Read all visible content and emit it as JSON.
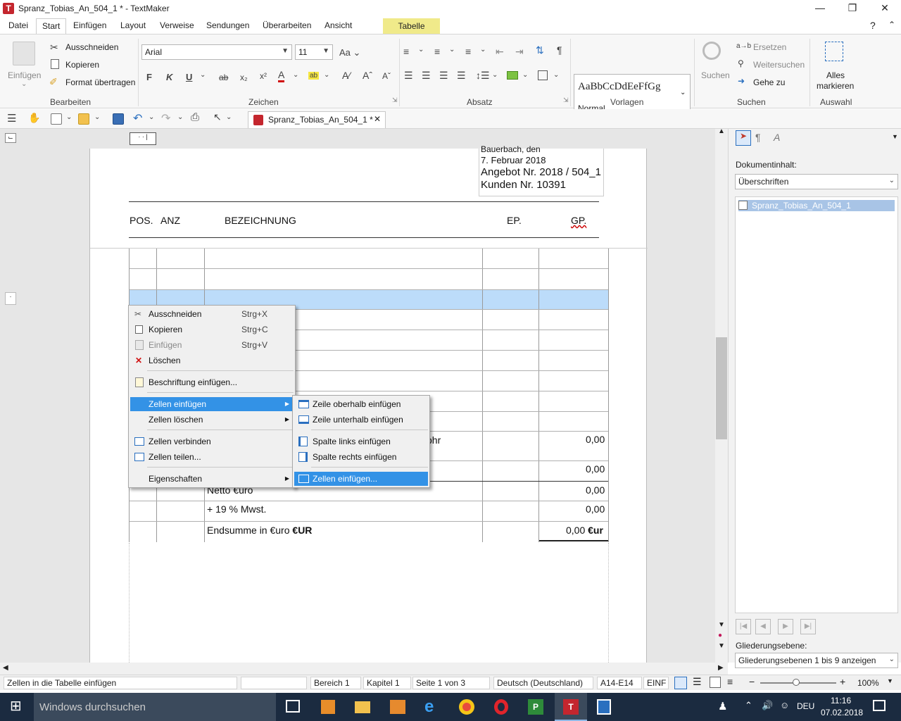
{
  "window": {
    "title": "Spranz_Tobias_An_504_1 * - TextMaker",
    "app_icon": "T"
  },
  "menu": {
    "items": [
      "Datei",
      "Start",
      "Einfügen",
      "Layout",
      "Verweise",
      "Sendungen",
      "Überarbeiten",
      "Ansicht"
    ],
    "context_tab": "Tabelle",
    "help": "?"
  },
  "ribbon": {
    "paste": "Einfügen",
    "cut": "Ausschneiden",
    "copy": "Kopieren",
    "format_painter": "Format übertragen",
    "group_edit": "Bearbeiten",
    "font": "Arial",
    "size": "11",
    "group_chars": "Zeichen",
    "group_para": "Absatz",
    "style_preview": "AaBbCcDdEeFfGg",
    "style_name": "Normal",
    "group_styles": "Vorlagen",
    "search": "Suchen",
    "replace": "Ersetzen",
    "search_next": "Weitersuchen",
    "goto": "Gehe zu",
    "group_search": "Suchen",
    "select_all_1": "Alles",
    "select_all_2": "markieren",
    "group_select": "Auswahl"
  },
  "doc_tab": {
    "label": "Spranz_Tobias_An_504_1 *"
  },
  "document": {
    "place_date": "Bauerbach, den",
    "date": "7. Februar 2018",
    "offer": "Angebot Nr. 2018 / 504_1",
    "customer": "Kunden Nr. 10391",
    "headers": [
      "POS.",
      "ANZ",
      "BEZEICHNUNG",
      "EP.",
      "GP."
    ],
    "partial_text": "ohr",
    "value_1": "0,00",
    "value_2": "0,00",
    "netto_label": "Netto €uro",
    "netto_value": "0,00",
    "mwst_label": "+ 19 % Mwst.",
    "mwst_value": "0,00",
    "total_label": "Endsumme in €uro",
    "total_label_bold": "€UR",
    "total_value": "0,00",
    "total_value_bold": "€ur"
  },
  "context_menu": {
    "cut": "Ausschneiden",
    "cut_sc": "Strg+X",
    "copy": "Kopieren",
    "copy_sc": "Strg+C",
    "paste": "Einfügen",
    "paste_sc": "Strg+V",
    "delete": "Löschen",
    "caption": "Beschriftung einfügen...",
    "insert_cells": "Zellen einfügen",
    "delete_cells": "Zellen löschen",
    "merge": "Zellen verbinden",
    "split": "Zellen teilen...",
    "properties": "Eigenschaften"
  },
  "submenu": {
    "above": "Zeile oberhalb einfügen",
    "below": "Zeile unterhalb einfügen",
    "left": "Spalte links einfügen",
    "right": "Spalte rechts einfügen",
    "cells": "Zellen einfügen..."
  },
  "side_panel": {
    "content_label": "Dokumentinhalt:",
    "content_select": "Überschriften",
    "tree_item": "Spranz_Tobias_An_504_1",
    "level_label": "Gliederungsebene:",
    "level_select": "Gliederungsebenen 1 bis 9 anzeigen"
  },
  "status": {
    "hint": "Zellen in die Tabelle einfügen",
    "area": "Bereich 1",
    "chapter": "Kapitel 1",
    "page": "Seite 1 von 3",
    "language": "Deutsch (Deutschland)",
    "cell": "A14-E14",
    "mode": "EINF",
    "zoom": "100%"
  },
  "taskbar": {
    "search": "Windows durchsuchen",
    "time": "11:16",
    "date": "07.02.2018",
    "lang": "DEU"
  },
  "colors": {
    "accent": "#3392e6",
    "row_highlight": "#bcdcfa",
    "tabelle_tab": "#f0ea8a",
    "taskbar": "#1b2b40"
  }
}
